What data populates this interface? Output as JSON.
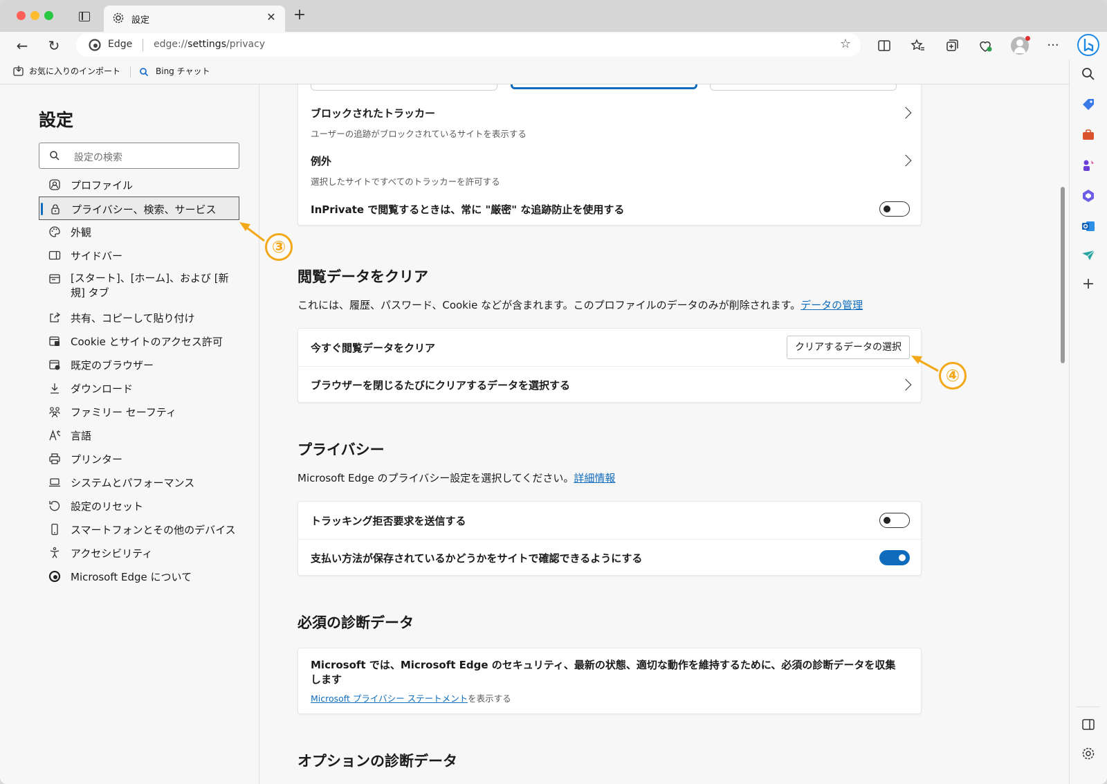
{
  "browser": {
    "tab_title": "設定",
    "address_brand": "Edge",
    "address_scheme": "edge://",
    "address_host": "settings",
    "address_path": "/privacy",
    "favorites": [
      {
        "label": "お気に入りのインポート",
        "icon": "import-favorites-icon"
      },
      {
        "label": "Bing チャット",
        "icon": "bing-search-icon"
      }
    ]
  },
  "nav": {
    "title": "設定",
    "search_placeholder": "設定の検索",
    "items": [
      {
        "label": "プロファイル",
        "icon": "profile-icon"
      },
      {
        "label": "プライバシー、検索、サービス",
        "icon": "lock-icon",
        "active": true
      },
      {
        "label": "外観",
        "icon": "palette-icon"
      },
      {
        "label": "サイドバー",
        "icon": "sidebar-icon"
      },
      {
        "label": "[スタート]、[ホーム]、および [新規] タブ",
        "icon": "start-home-icon"
      },
      {
        "label": "共有、コピーして貼り付け",
        "icon": "share-icon"
      },
      {
        "label": "Cookie とサイトのアクセス許可",
        "icon": "cookie-permissions-icon"
      },
      {
        "label": "既定のブラウザー",
        "icon": "default-browser-icon"
      },
      {
        "label": "ダウンロード",
        "icon": "download-icon"
      },
      {
        "label": "ファミリー セーフティ",
        "icon": "family-icon"
      },
      {
        "label": "言語",
        "icon": "language-icon"
      },
      {
        "label": "プリンター",
        "icon": "printer-icon"
      },
      {
        "label": "システムとパフォーマンス",
        "icon": "laptop-icon"
      },
      {
        "label": "設定のリセット",
        "icon": "reset-icon"
      },
      {
        "label": "スマートフォンとその他のデバイス",
        "icon": "phone-icon"
      },
      {
        "label": "アクセシビリティ",
        "icon": "accessibility-icon"
      },
      {
        "label": "Microsoft Edge について",
        "icon": "edge-logo-icon"
      }
    ]
  },
  "tracking": {
    "blocked_title": "ブロックされたトラッカー",
    "blocked_sub": "ユーザーの追跡がブロックされているサイトを表示する",
    "exceptions_title": "例外",
    "exceptions_sub": "選択したサイトですべてのトラッカーを許可する",
    "inprivate_label": "InPrivate で閲覧するときは、常に \"厳密\" な追跡防止を使用する",
    "inprivate_on": false
  },
  "clear_data": {
    "heading": "閲覧データをクリア",
    "desc": "これには、履歴、パスワード、Cookie などが含まれます。このプロファイルのデータのみが削除されます。",
    "desc_link": "データの管理",
    "now_label": "今すぐ閲覧データをクリア",
    "choose_button": "クリアするデータの選択",
    "on_close_label": "ブラウザーを閉じるたびにクリアするデータを選択する"
  },
  "privacy": {
    "heading": "プライバシー",
    "desc": "Microsoft Edge のプライバシー設定を選択してください。",
    "desc_link": "詳細情報",
    "dnt_label": "トラッキング拒否要求を送信する",
    "dnt_on": false,
    "payment_label": "支払い方法が保存されているかどうかをサイトで確認できるようにする",
    "payment_on": true
  },
  "diagnostics": {
    "heading": "必須の診断データ",
    "body": "Microsoft では、Microsoft Edge のセキュリティ、最新の状態、適切な動作を維持するために、必須の診断データを収集します",
    "link": "Microsoft プライバシー ステートメント",
    "link_suffix": "を表示する"
  },
  "optional_heading": "オプションの診断データ",
  "annotations": [
    "③",
    "④"
  ],
  "colors": {
    "accent": "#0f6cbd",
    "annotation": "#f2a818"
  }
}
